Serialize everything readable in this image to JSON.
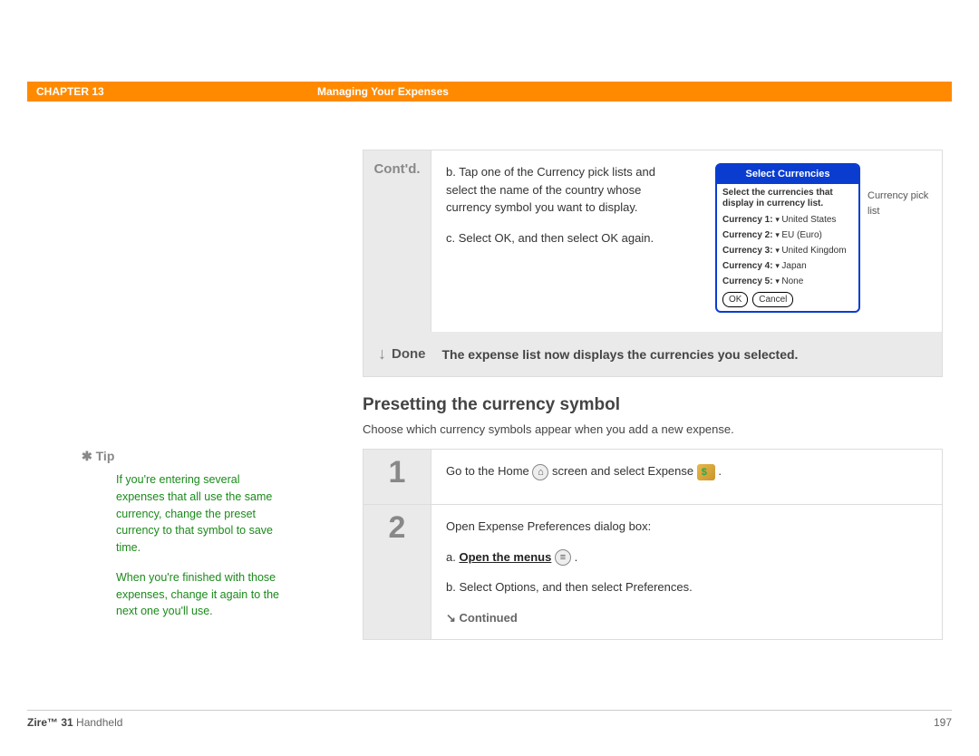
{
  "header": {
    "chapter": "CHAPTER 13",
    "title": "Managing Your Expenses"
  },
  "contd": {
    "label": "Cont'd.",
    "step_b": "b.  Tap one of the Currency pick lists and select the name of the country whose currency symbol you want to display.",
    "step_c": "c.  Select OK, and then select OK again."
  },
  "palm": {
    "title": "Select Currencies",
    "instruction": "Select the currencies that display in currency list.",
    "rows": [
      {
        "label": "Currency 1:",
        "value": "United States"
      },
      {
        "label": "Currency 2:",
        "value": "EU (Euro)"
      },
      {
        "label": "Currency 3:",
        "value": "United Kingdom"
      },
      {
        "label": "Currency 4:",
        "value": "Japan"
      },
      {
        "label": "Currency 5:",
        "value": "None"
      }
    ],
    "ok": "OK",
    "cancel": "Cancel",
    "note": "Currency pick list"
  },
  "done": {
    "label": "Done",
    "text": "The expense list now displays the currencies you selected."
  },
  "section": {
    "heading": "Presetting the currency symbol",
    "sub": "Choose which currency symbols appear when you add a new expense."
  },
  "steps": {
    "s1_pre": "Go to the Home ",
    "s1_mid": " screen and select Expense ",
    "s1_post": " .",
    "s2_intro": "Open Expense Preferences dialog box:",
    "s2_a_pre": "a.  ",
    "s2_a_link": "Open the menus",
    "s2_a_post": " .",
    "s2_b": "b.  Select Options, and then select Preferences."
  },
  "continued": "Continued",
  "tip": {
    "label": "Tip",
    "p1": "If you're entering several expenses that all use the same currency, change the preset currency to that symbol to save time.",
    "p2": "When you're finished with those expenses, change it again to the next one you'll use."
  },
  "footer": {
    "product_bold": "Zire™ 31",
    "product_rest": " Handheld",
    "page": "197"
  }
}
